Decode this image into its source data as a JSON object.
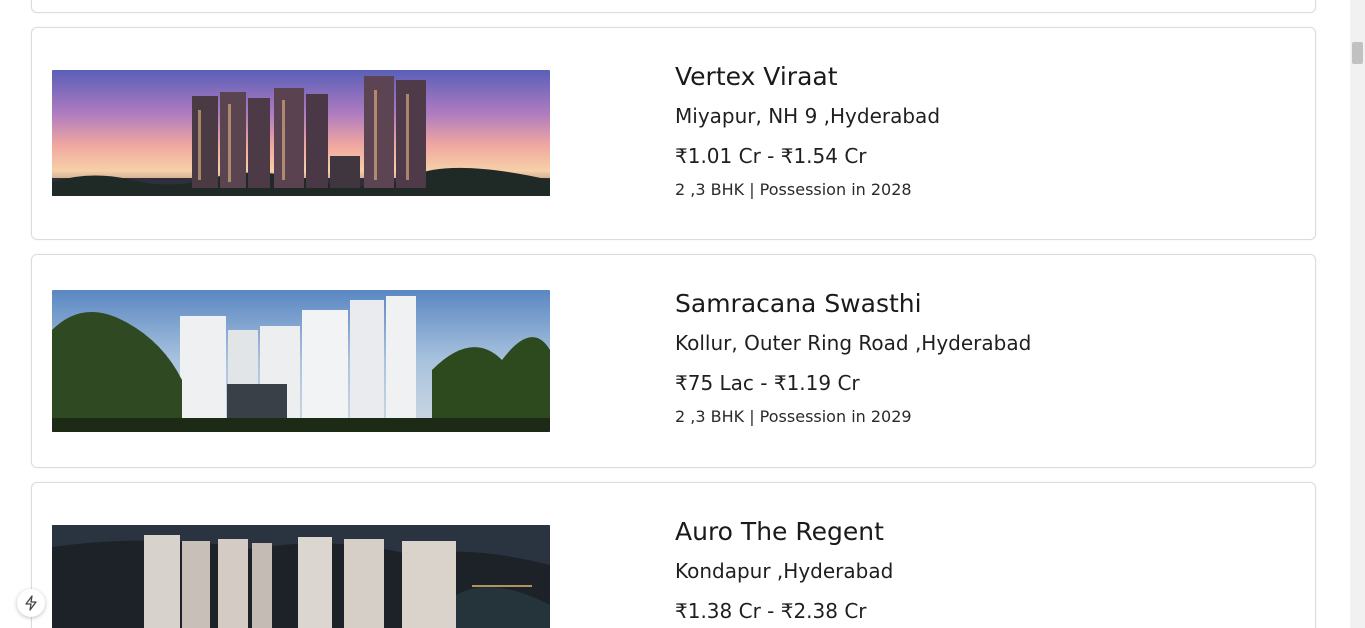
{
  "listings": [
    {
      "title": "Vertex Viraat",
      "location": "Miyapur, NH 9 ,Hyderabad",
      "price": "₹1.01 Cr - ₹1.54 Cr",
      "meta": "2 ,3 BHK | Possession in 2028"
    },
    {
      "title": "Samracana Swasthi",
      "location": "Kollur, Outer Ring Road ,Hyderabad",
      "price": "₹75 Lac - ₹1.19 Cr",
      "meta": "2 ,3 BHK | Possession in 2029"
    },
    {
      "title": "Auro The Regent",
      "location": "Kondapur ,Hyderabad",
      "price": "₹1.38 Cr - ₹2.38 Cr"
    }
  ],
  "icons": {
    "fab": "lightning-icon"
  },
  "colors": {
    "card_border": "#dcdcdc",
    "text": "#1f1f1f",
    "scrollbar_track": "#f1f1f1",
    "scrollbar_thumb": "#c1c1c1"
  }
}
